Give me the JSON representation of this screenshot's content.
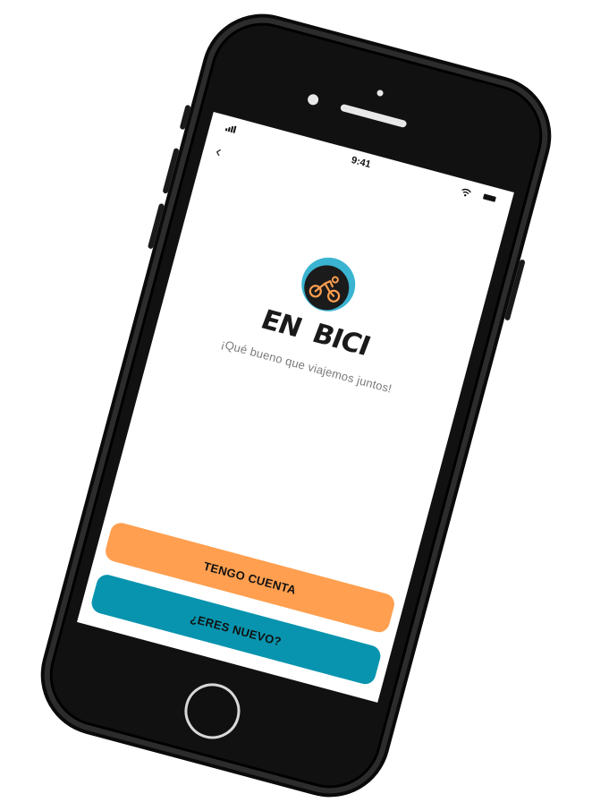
{
  "status_bar": {
    "time": "9:41"
  },
  "nav": {
    "back_icon": "chevron-left-icon",
    "back_glyph": "‹"
  },
  "brand": {
    "name_left": "EN",
    "name_right": "BICI",
    "tagline": "¡Qué bueno que viajemos juntos!",
    "logo_icon": "bicycle-rider-icon"
  },
  "actions": {
    "login_label": "TENGO CUENTA",
    "signup_label": "¿ERES NUEVO?"
  },
  "colors": {
    "primary_orange": "#ff9f4f",
    "primary_teal": "#0894ae",
    "logo_accent": "#3ab4d1",
    "phone_frame": "#111111"
  }
}
